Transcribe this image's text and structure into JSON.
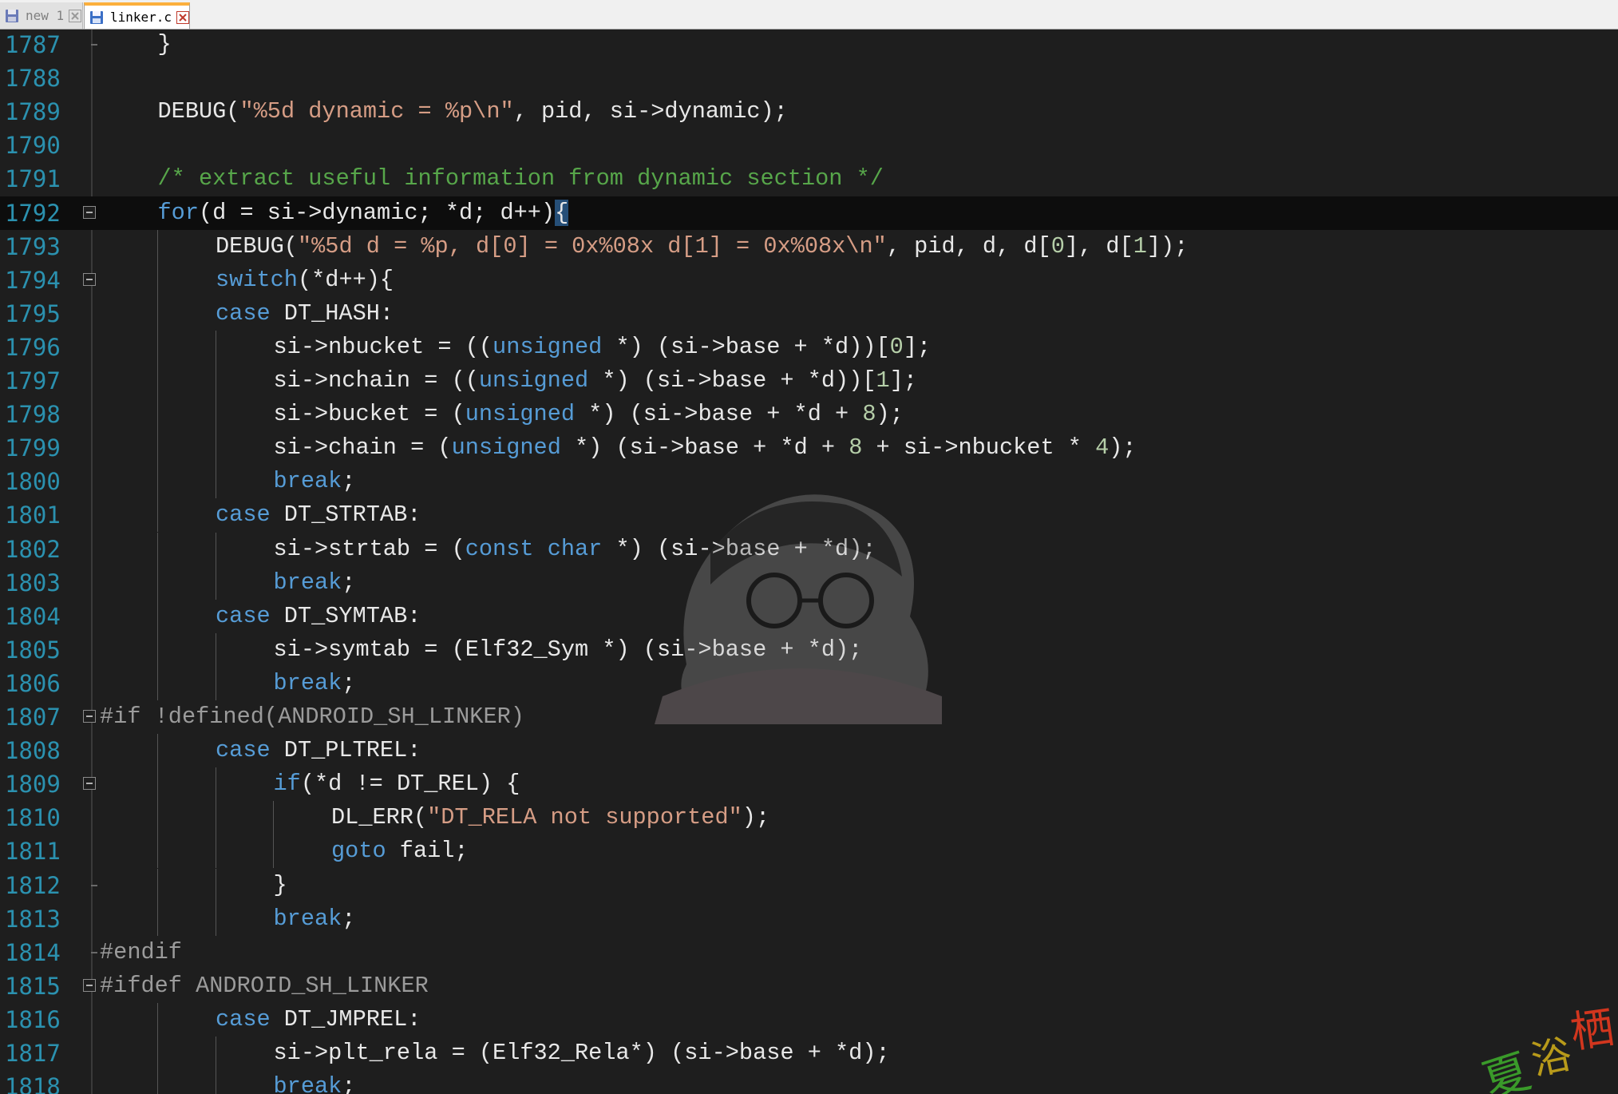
{
  "tabs": [
    {
      "label": "new 1",
      "active": false
    },
    {
      "label": "linker.c",
      "active": true
    }
  ],
  "colors": {
    "background": "#1e1e1e",
    "line_number": "#2b91af",
    "keyword": "#569cd6",
    "string": "#d69d85",
    "number": "#b5cea8",
    "comment": "#57a64a",
    "preprocessor": "#9b9b9b",
    "tab_accent": "#fbaf3c"
  },
  "editor": {
    "lines": [
      {
        "n": "1787",
        "indent": 1,
        "fold": "end",
        "tokens": [
          {
            "t": "pn",
            "v": "}"
          }
        ]
      },
      {
        "n": "1788",
        "indent": 0,
        "fold": "",
        "tokens": []
      },
      {
        "n": "1789",
        "indent": 1,
        "fold": "",
        "tokens": [
          {
            "t": "pn",
            "v": "DEBUG("
          },
          {
            "t": "str",
            "v": "\"%5d dynamic = %p\\n\""
          },
          {
            "t": "pn",
            "v": ", pid, si->dynamic);"
          }
        ]
      },
      {
        "n": "1790",
        "indent": 0,
        "fold": "",
        "tokens": []
      },
      {
        "n": "1791",
        "indent": 1,
        "fold": "",
        "tokens": [
          {
            "t": "cmt",
            "v": "/* extract useful information from dynamic section */"
          }
        ]
      },
      {
        "n": "1792",
        "indent": 1,
        "fold": "box",
        "current": true,
        "tokens": [
          {
            "t": "kw",
            "v": "for"
          },
          {
            "t": "pn",
            "v": "(d = si->dynamic; *d; d++)"
          },
          {
            "t": "caret",
            "v": "{"
          }
        ]
      },
      {
        "n": "1793",
        "indent": 2,
        "fold": "",
        "tokens": [
          {
            "t": "pn",
            "v": "DEBUG("
          },
          {
            "t": "str",
            "v": "\"%5d d = %p, d[0] = 0x%08x d[1] = 0x%08x\\n\""
          },
          {
            "t": "pn",
            "v": ", pid, d, d["
          },
          {
            "t": "num",
            "v": "0"
          },
          {
            "t": "pn",
            "v": "], d["
          },
          {
            "t": "num",
            "v": "1"
          },
          {
            "t": "pn",
            "v": "]);"
          }
        ]
      },
      {
        "n": "1794",
        "indent": 2,
        "fold": "box",
        "tokens": [
          {
            "t": "kw",
            "v": "switch"
          },
          {
            "t": "pn",
            "v": "(*d++){"
          }
        ]
      },
      {
        "n": "1795",
        "indent": 2,
        "fold": "",
        "tokens": [
          {
            "t": "kw",
            "v": "case"
          },
          {
            "t": "pn",
            "v": " DT_HASH:"
          }
        ]
      },
      {
        "n": "1796",
        "indent": 3,
        "fold": "",
        "tokens": [
          {
            "t": "pn",
            "v": "si->nbucket = (("
          },
          {
            "t": "kw",
            "v": "unsigned"
          },
          {
            "t": "pn",
            "v": " *) (si->base + *d))["
          },
          {
            "t": "num",
            "v": "0"
          },
          {
            "t": "pn",
            "v": "];"
          }
        ]
      },
      {
        "n": "1797",
        "indent": 3,
        "fold": "",
        "tokens": [
          {
            "t": "pn",
            "v": "si->nchain = (("
          },
          {
            "t": "kw",
            "v": "unsigned"
          },
          {
            "t": "pn",
            "v": " *) (si->base + *d))["
          },
          {
            "t": "num",
            "v": "1"
          },
          {
            "t": "pn",
            "v": "];"
          }
        ]
      },
      {
        "n": "1798",
        "indent": 3,
        "fold": "",
        "tokens": [
          {
            "t": "pn",
            "v": "si->bucket = ("
          },
          {
            "t": "kw",
            "v": "unsigned"
          },
          {
            "t": "pn",
            "v": " *) (si->base + *d + "
          },
          {
            "t": "num",
            "v": "8"
          },
          {
            "t": "pn",
            "v": ");"
          }
        ]
      },
      {
        "n": "1799",
        "indent": 3,
        "fold": "",
        "tokens": [
          {
            "t": "pn",
            "v": "si->chain = ("
          },
          {
            "t": "kw",
            "v": "unsigned"
          },
          {
            "t": "pn",
            "v": " *) (si->base + *d + "
          },
          {
            "t": "num",
            "v": "8"
          },
          {
            "t": "pn",
            "v": " + si->nbucket * "
          },
          {
            "t": "num",
            "v": "4"
          },
          {
            "t": "pn",
            "v": ");"
          }
        ]
      },
      {
        "n": "1800",
        "indent": 3,
        "fold": "",
        "tokens": [
          {
            "t": "kw",
            "v": "break"
          },
          {
            "t": "pn",
            "v": ";"
          }
        ]
      },
      {
        "n": "1801",
        "indent": 2,
        "fold": "",
        "tokens": [
          {
            "t": "kw",
            "v": "case"
          },
          {
            "t": "pn",
            "v": " DT_STRTAB:"
          }
        ]
      },
      {
        "n": "1802",
        "indent": 3,
        "fold": "",
        "tokens": [
          {
            "t": "pn",
            "v": "si->strtab = ("
          },
          {
            "t": "kw",
            "v": "const"
          },
          {
            "t": "pn",
            "v": " "
          },
          {
            "t": "kw",
            "v": "char"
          },
          {
            "t": "pn",
            "v": " *) (si->base + *d);"
          }
        ]
      },
      {
        "n": "1803",
        "indent": 3,
        "fold": "",
        "tokens": [
          {
            "t": "kw",
            "v": "break"
          },
          {
            "t": "pn",
            "v": ";"
          }
        ]
      },
      {
        "n": "1804",
        "indent": 2,
        "fold": "",
        "tokens": [
          {
            "t": "kw",
            "v": "case"
          },
          {
            "t": "pn",
            "v": " DT_SYMTAB:"
          }
        ]
      },
      {
        "n": "1805",
        "indent": 3,
        "fold": "",
        "tokens": [
          {
            "t": "pn",
            "v": "si->symtab = (Elf32_Sym *) (si->base + *d);"
          }
        ]
      },
      {
        "n": "1806",
        "indent": 3,
        "fold": "",
        "tokens": [
          {
            "t": "kw",
            "v": "break"
          },
          {
            "t": "pn",
            "v": ";"
          }
        ]
      },
      {
        "n": "1807",
        "indent": 0,
        "fold": "box",
        "tokens": [
          {
            "t": "pp",
            "v": "#if !defined(ANDROID_SH_LINKER)"
          }
        ]
      },
      {
        "n": "1808",
        "indent": 2,
        "fold": "",
        "tokens": [
          {
            "t": "kw",
            "v": "case"
          },
          {
            "t": "pn",
            "v": " DT_PLTREL:"
          }
        ]
      },
      {
        "n": "1809",
        "indent": 3,
        "fold": "box",
        "tokens": [
          {
            "t": "kw",
            "v": "if"
          },
          {
            "t": "pn",
            "v": "(*d != DT_REL) {"
          }
        ]
      },
      {
        "n": "1810",
        "indent": 4,
        "fold": "",
        "tokens": [
          {
            "t": "pn",
            "v": "DL_ERR("
          },
          {
            "t": "str",
            "v": "\"DT_RELA not supported\""
          },
          {
            "t": "pn",
            "v": ");"
          }
        ]
      },
      {
        "n": "1811",
        "indent": 4,
        "fold": "",
        "tokens": [
          {
            "t": "kw",
            "v": "goto"
          },
          {
            "t": "pn",
            "v": " fail;"
          }
        ]
      },
      {
        "n": "1812",
        "indent": 3,
        "fold": "end",
        "tokens": [
          {
            "t": "pn",
            "v": "}"
          }
        ]
      },
      {
        "n": "1813",
        "indent": 3,
        "fold": "",
        "tokens": [
          {
            "t": "kw",
            "v": "break"
          },
          {
            "t": "pn",
            "v": ";"
          }
        ]
      },
      {
        "n": "1814",
        "indent": 0,
        "fold": "end",
        "tokens": [
          {
            "t": "pp",
            "v": "#endif"
          }
        ]
      },
      {
        "n": "1815",
        "indent": 0,
        "fold": "box",
        "tokens": [
          {
            "t": "pp",
            "v": "#ifdef ANDROID_SH_LINKER"
          }
        ]
      },
      {
        "n": "1816",
        "indent": 2,
        "fold": "",
        "tokens": [
          {
            "t": "kw",
            "v": "case"
          },
          {
            "t": "pn",
            "v": " DT_JMPREL:"
          }
        ]
      },
      {
        "n": "1817",
        "indent": 3,
        "fold": "",
        "tokens": [
          {
            "t": "pn",
            "v": "si->plt_rela = (Elf32_Rela*) (si->base + *d);"
          }
        ]
      },
      {
        "n": "1818",
        "indent": 3,
        "fold": "",
        "tokens": [
          {
            "t": "kw",
            "v": "break"
          },
          {
            "t": "pn",
            "v": ";"
          }
        ]
      }
    ]
  },
  "watermark": {
    "stamp_text": "夏浴栖",
    "mascot": "anime-boy-glasses-illustration"
  }
}
